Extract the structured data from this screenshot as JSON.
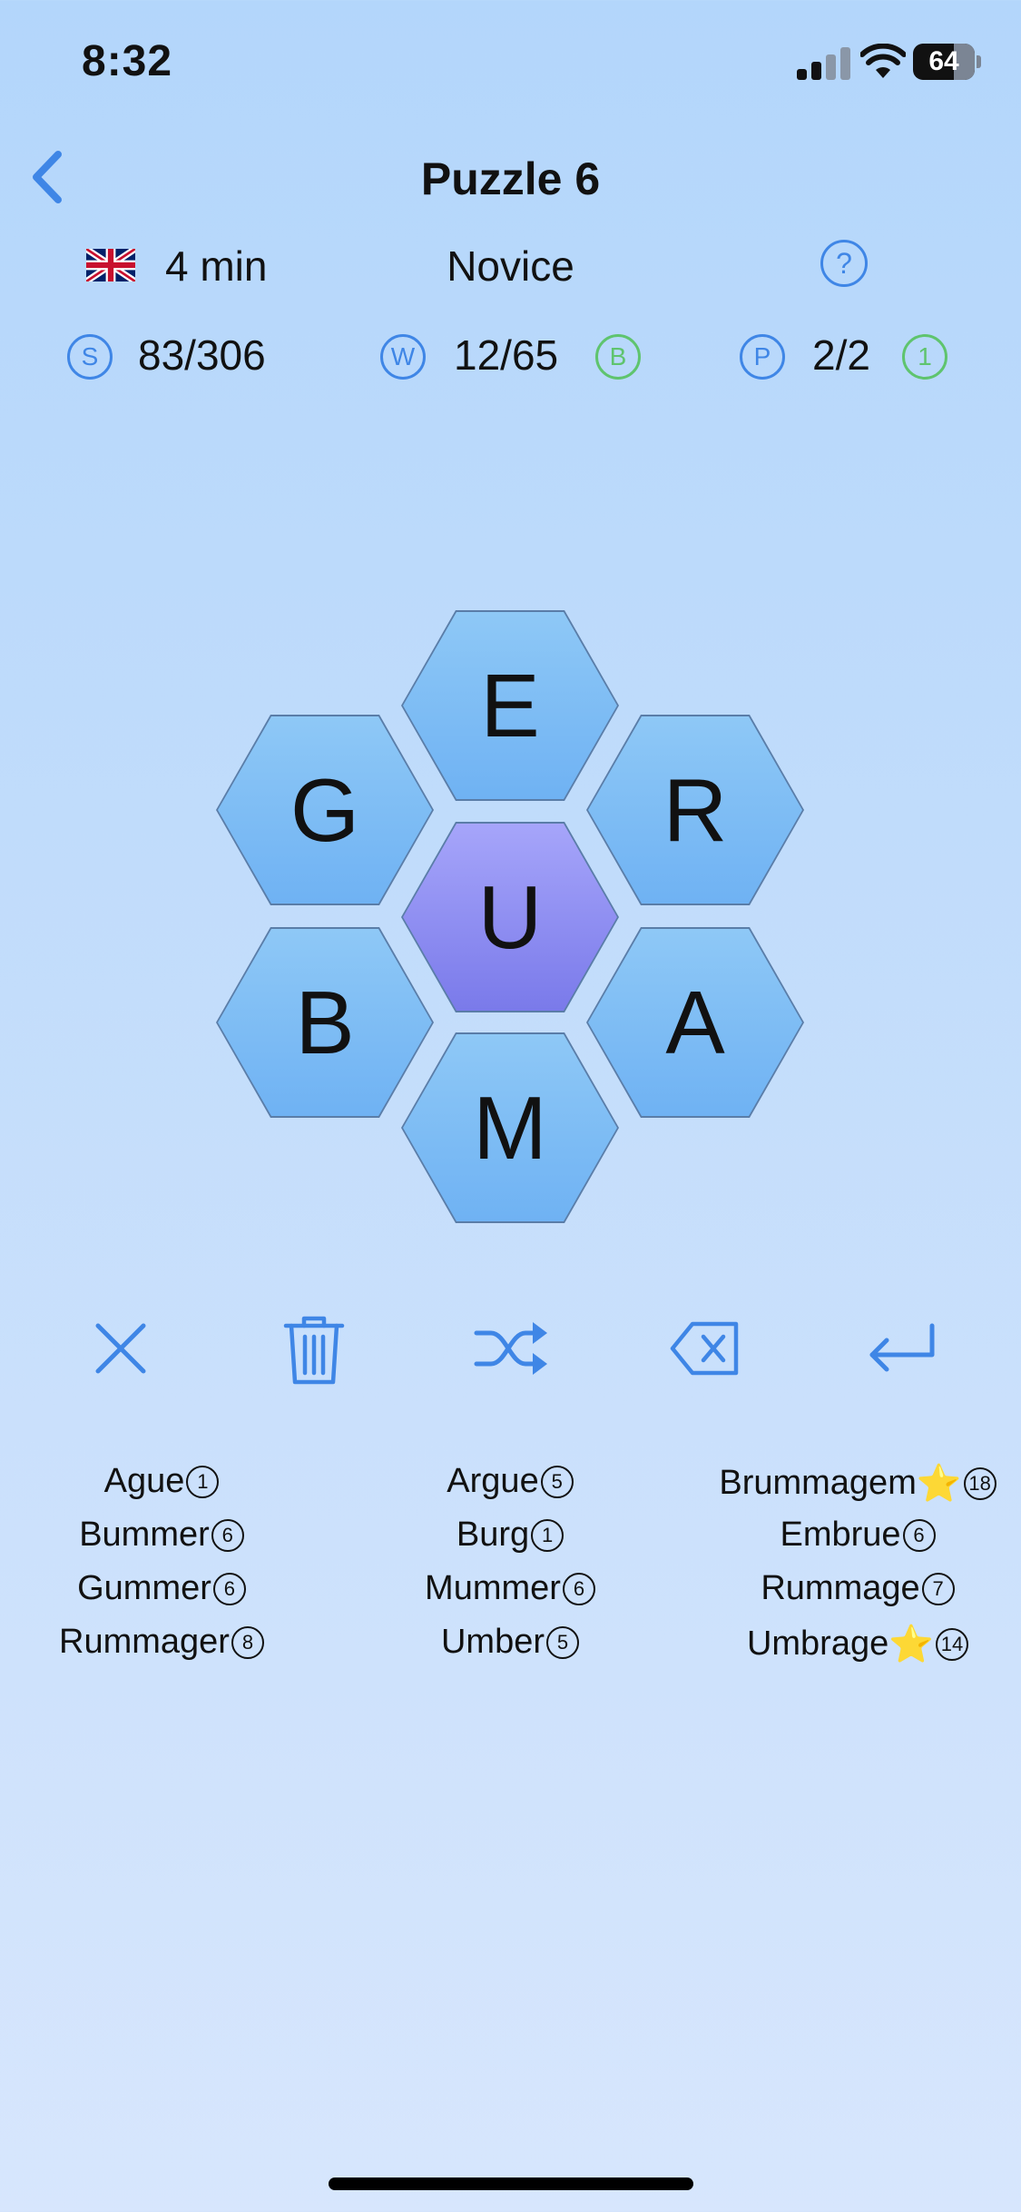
{
  "status_bar": {
    "time": "8:32",
    "battery": "64"
  },
  "header": {
    "title": "Puzzle 6"
  },
  "info": {
    "duration": "4 min",
    "level": "Novice",
    "help_icon": "?"
  },
  "stats": {
    "score": {
      "icon": "S",
      "value": "83/306"
    },
    "words": {
      "icon": "W",
      "value": "12/65",
      "badge": "B"
    },
    "pangrams": {
      "icon": "P",
      "value": "2/2",
      "badge": "1"
    }
  },
  "letters": {
    "top": "E",
    "upper_left": "G",
    "upper_right": "R",
    "center": "U",
    "lower_left": "B",
    "lower_right": "A",
    "bottom": "M"
  },
  "colors": {
    "accent": "#3f86e6",
    "hex": "#7ab9f4",
    "center_hex": "#8f8ff2",
    "badge_green": "#5fc46e"
  },
  "words": [
    {
      "word": "Ague",
      "points": "1",
      "star": false
    },
    {
      "word": "Argue",
      "points": "5",
      "star": false
    },
    {
      "word": "Brummagem",
      "points": "18",
      "star": true
    },
    {
      "word": "Bummer",
      "points": "6",
      "star": false
    },
    {
      "word": "Burg",
      "points": "1",
      "star": false
    },
    {
      "word": "Embrue",
      "points": "6",
      "star": false
    },
    {
      "word": "Gummer",
      "points": "6",
      "star": false
    },
    {
      "word": "Mummer",
      "points": "6",
      "star": false
    },
    {
      "word": "Rummage",
      "points": "7",
      "star": false
    },
    {
      "word": "Rummager",
      "points": "8",
      "star": false
    },
    {
      "word": "Umber",
      "points": "5",
      "star": false
    },
    {
      "word": "Umbrage",
      "points": "14",
      "star": true
    }
  ],
  "star_icon": "⭐"
}
